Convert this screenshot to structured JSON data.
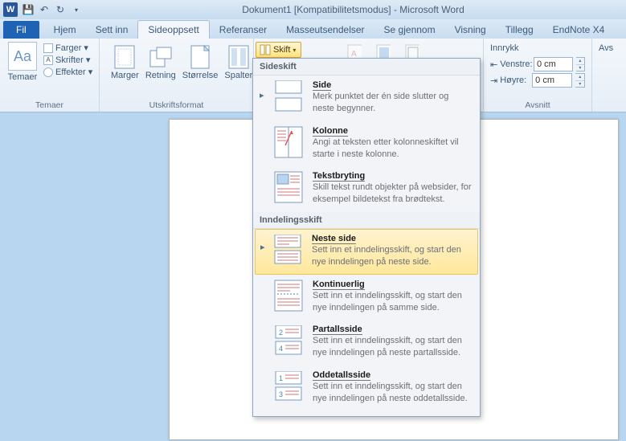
{
  "titlebar": {
    "title": "Dokument1 [Kompatibilitetsmodus] - Microsoft Word"
  },
  "tabs": {
    "fil": "Fil",
    "hjem": "Hjem",
    "settinn": "Sett inn",
    "sideoppsett": "Sideoppsett",
    "referanser": "Referanser",
    "masseutsendelser": "Masseutsendelser",
    "segjennom": "Se gjennom",
    "visning": "Visning",
    "tillegg": "Tillegg",
    "endnote": "EndNote X4"
  },
  "themes": {
    "main": "Temaer",
    "farger": "Farger",
    "skrifter": "Skrifter",
    "effekter": "Effekter",
    "group": "Temaer"
  },
  "pagegroup": {
    "marger": "Marger",
    "retning": "Retning",
    "storrelse": "Størrelse",
    "spalter": "Spalter",
    "group": "Utskriftsformat"
  },
  "skiftbtn": "Skift",
  "innrykk": {
    "title": "Innrykk",
    "venstre": "Venstre:",
    "hoyre": "Høyre:",
    "vval": "0 cm",
    "hval": "0 cm"
  },
  "avsnitt": {
    "label": "Avsnitt",
    "avs": "Avs"
  },
  "dropdown": {
    "h1": "Sideskift",
    "side_t": "Side",
    "side_d": "Merk punktet der én side slutter og neste begynner.",
    "kol_t": "Kolonne",
    "kol_d": "Angi at teksten etter kolonneskiftet vil starte i neste kolonne.",
    "tb_t": "Tekstbryting",
    "tb_d": "Skill tekst rundt objekter på websider, for eksempel bildetekst fra brødtekst.",
    "h2": "Inndelingsskift",
    "ns_t": "Neste side",
    "ns_d": "Sett inn et inndelingsskift, og start den nye inndelingen på neste side.",
    "kont_t": "Kontinuerlig",
    "kont_d": "Sett inn et inndelingsskift, og start den nye inndelingen på samme side.",
    "par_t": "Partallsside",
    "par_d": "Sett inn et inndelingsskift, og start den nye inndelingen på neste partallsside.",
    "odd_t": "Oddetallsside",
    "odd_d": "Sett inn et inndelingsskift, og start den nye inndelingen på neste oddetallsside."
  }
}
